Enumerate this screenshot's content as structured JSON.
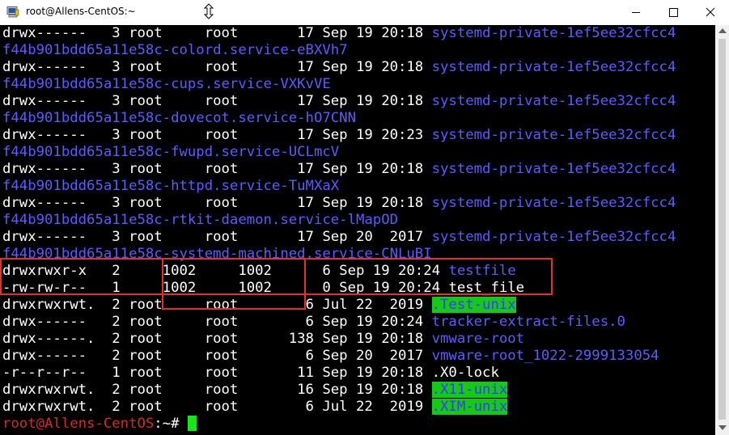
{
  "window": {
    "title": "root@Allens-CentOS:~",
    "controls": {
      "minimize_icon": "minimize-icon",
      "maximize_icon": "maximize-icon",
      "close_icon": "close-icon"
    }
  },
  "colors": {
    "terminal_bg": "#000000",
    "text": "#ffffff",
    "directory": "#5c5cff",
    "prompt": "#d22c2c",
    "sticky_dir_bg": "#18c818",
    "cursor": "#19e619",
    "annotation_box": "#e03030"
  },
  "lines": [
    [
      {
        "t": "drwx------   3 root     root       17 Sep 19 20:18 ",
        "c": "white"
      },
      {
        "t": "systemd-private-1ef5ee32cfcc4",
        "c": "blue"
      }
    ],
    [
      {
        "t": "f44b901bdd65a11e58c-colord.service-eBXVh7",
        "c": "blue"
      }
    ],
    [
      {
        "t": "drwx------   3 root     root       17 Sep 19 20:18 ",
        "c": "white"
      },
      {
        "t": "systemd-private-1ef5ee32cfcc4",
        "c": "blue"
      }
    ],
    [
      {
        "t": "f44b901bdd65a11e58c-cups.service-VXKvVE",
        "c": "blue"
      }
    ],
    [
      {
        "t": "drwx------   3 root     root       17 Sep 19 20:18 ",
        "c": "white"
      },
      {
        "t": "systemd-private-1ef5ee32cfcc4",
        "c": "blue"
      }
    ],
    [
      {
        "t": "f44b901bdd65a11e58c-dovecot.service-hO7CNN",
        "c": "blue"
      }
    ],
    [
      {
        "t": "drwx------   3 root     root       17 Sep 19 20:23 ",
        "c": "white"
      },
      {
        "t": "systemd-private-1ef5ee32cfcc4",
        "c": "blue"
      }
    ],
    [
      {
        "t": "f44b901bdd65a11e58c-fwupd.service-UCLmcV",
        "c": "blue"
      }
    ],
    [
      {
        "t": "drwx------   3 root     root       17 Sep 19 20:18 ",
        "c": "white"
      },
      {
        "t": "systemd-private-1ef5ee32cfcc4",
        "c": "blue"
      }
    ],
    [
      {
        "t": "f44b901bdd65a11e58c-httpd.service-TuMXaX",
        "c": "blue"
      }
    ],
    [
      {
        "t": "drwx------   3 root     root       17 Sep 19 20:18 ",
        "c": "white"
      },
      {
        "t": "systemd-private-1ef5ee32cfcc4",
        "c": "blue"
      }
    ],
    [
      {
        "t": "f44b901bdd65a11e58c-rtkit-daemon.service-lMapOD",
        "c": "blue"
      }
    ],
    [
      {
        "t": "drwx------   3 root     root       17 Sep 20  2017 ",
        "c": "white"
      },
      {
        "t": "systemd-private-1ef5ee32cfcc4",
        "c": "blue"
      }
    ],
    [
      {
        "t": "f44b901bdd65a11e58c-systemd-machined.service-CNLuBI",
        "c": "blue"
      }
    ],
    [
      {
        "t": "drwxrwxr-x   2     1002     1002      6 Sep 19 20:24 ",
        "c": "white"
      },
      {
        "t": "testfile",
        "c": "blue"
      }
    ],
    [
      {
        "t": "-rw-rw-r--   1     1002     1002      0 Sep 19 20:24 ",
        "c": "white"
      },
      {
        "t": "test_file",
        "c": "white"
      }
    ],
    [
      {
        "t": "drwxrwxrwt.  2 root     root        6 Jul 22  2019 ",
        "c": "white"
      },
      {
        "t": ".Test-unix",
        "c": "hl"
      }
    ],
    [
      {
        "t": "drwx------   2 root     root        6 Sep 19 20:24 ",
        "c": "white"
      },
      {
        "t": "tracker-extract-files.0",
        "c": "blue"
      }
    ],
    [
      {
        "t": "drwx------.  2 root     root      138 Sep 19 20:18 ",
        "c": "white"
      },
      {
        "t": "vmware-root",
        "c": "blue"
      }
    ],
    [
      {
        "t": "drwx------   2 root     root        6 Sep 20  2017 ",
        "c": "white"
      },
      {
        "t": "vmware-root_1022-2999133054",
        "c": "blue"
      }
    ],
    [
      {
        "t": "-r--r--r--   1 root     root       11 Sep 19 20:18 ",
        "c": "white"
      },
      {
        "t": ".X0-lock",
        "c": "white"
      }
    ],
    [
      {
        "t": "drwxrwxrwt.  2 root     root       16 Sep 19 20:18 ",
        "c": "white"
      },
      {
        "t": ".X11-unix",
        "c": "hl"
      }
    ],
    [
      {
        "t": "drwxrwxrwt.  2 root     root        6 Jul 22  2019 ",
        "c": "white"
      },
      {
        "t": ".XIM-unix",
        "c": "hl"
      }
    ]
  ],
  "prompt": {
    "text": "root@Allens-CentOS",
    "suffix": ":~# "
  }
}
